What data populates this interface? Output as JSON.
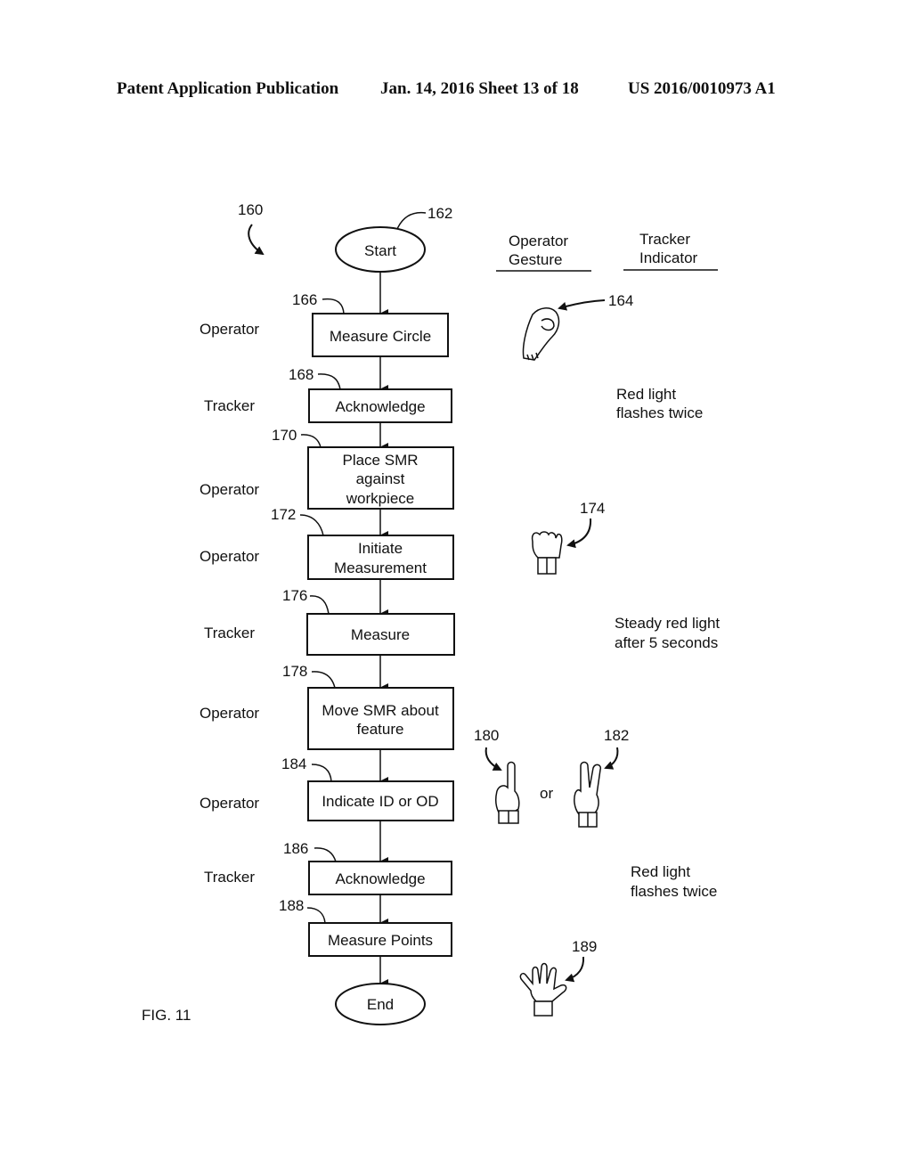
{
  "header": {
    "publication": "Patent Application Publication",
    "date_sheet": "Jan. 14, 2016  Sheet 13 of 18",
    "number": "US 2016/0010973 A1"
  },
  "figure": {
    "label": "FIG. 11",
    "ref": "160",
    "columns": {
      "gesture": [
        "Operator",
        "Gesture"
      ],
      "indicator": [
        "Tracker",
        "Indicator"
      ]
    },
    "start": {
      "label": "Start",
      "ref": "162"
    },
    "end": {
      "label": "End"
    },
    "steps": [
      {
        "ref": "166",
        "actor": "Operator",
        "lines": [
          "Measure Circle"
        ]
      },
      {
        "ref": "168",
        "actor": "Tracker",
        "lines": [
          "Acknowledge"
        ]
      },
      {
        "ref": "170",
        "actor": "Operator",
        "lines": [
          "Place SMR",
          "against",
          "workpiece"
        ]
      },
      {
        "ref": "172",
        "actor": "Operator",
        "lines": [
          "Initiate",
          "Measurement"
        ]
      },
      {
        "ref": "176",
        "actor": "Tracker",
        "lines": [
          "Measure"
        ]
      },
      {
        "ref": "178",
        "actor": "Operator",
        "lines": [
          "Move SMR about",
          "feature"
        ]
      },
      {
        "ref": "184",
        "actor": "Operator",
        "lines": [
          "Indicate ID or OD"
        ]
      },
      {
        "ref": "186",
        "actor": "Tracker",
        "lines": [
          "Acknowledge"
        ]
      },
      {
        "ref": "188",
        "actor": "",
        "lines": [
          "Measure Points"
        ]
      }
    ],
    "indicators": [
      {
        "lines": [
          "Red light",
          "flashes twice"
        ]
      },
      {
        "lines": [
          "Steady red light",
          "after 5 seconds"
        ]
      },
      {
        "lines": [
          "Red light",
          "flashes twice"
        ]
      }
    ],
    "gestures": [
      {
        "ref": "164",
        "icon": "hand-circle-gesture-icon"
      },
      {
        "ref": "174",
        "icon": "fist-gesture-icon"
      },
      {
        "ref": "180",
        "icon": "one-finger-gesture-icon"
      },
      {
        "ref": "182",
        "icon": "two-finger-gesture-icon"
      },
      {
        "ref": "189",
        "icon": "open-hand-gesture-icon"
      }
    ],
    "or_label": "or"
  }
}
